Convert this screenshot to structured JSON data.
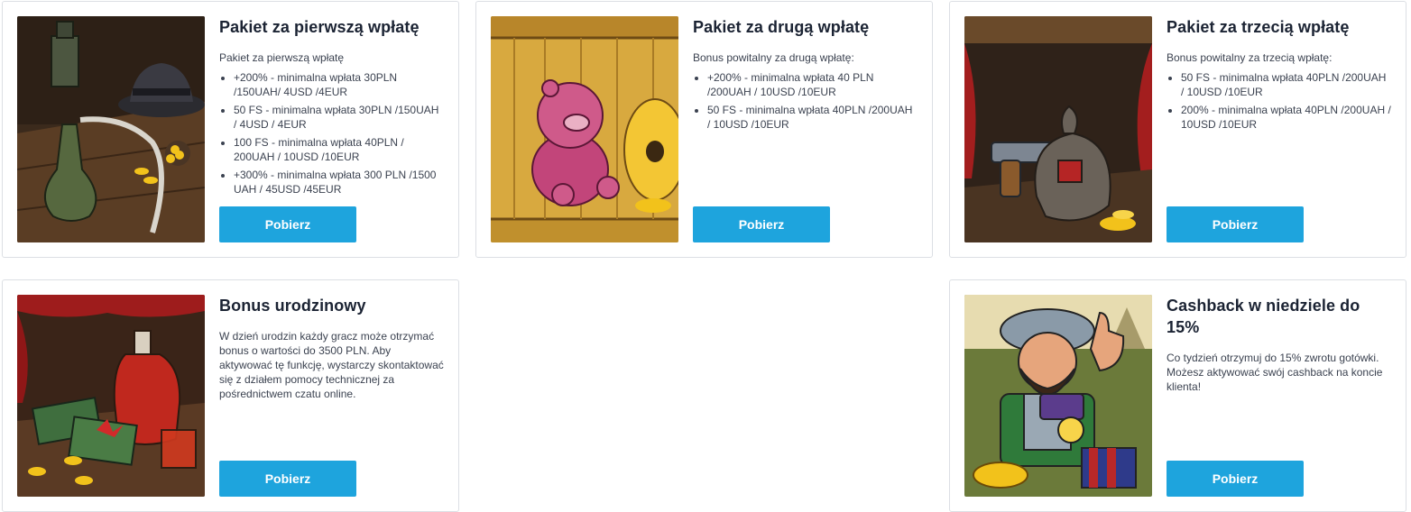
{
  "cards": [
    {
      "title": "Pakiet za pierwszą wpłatę",
      "description": "Pakiet za pierwszą wpłatę",
      "items": [
        "+200% - minimalna wpłata 30PLN /150UAH/ 4USD /4EUR",
        "50 FS - minimalna wpłata 30PLN /150UAH / 4USD / 4EUR",
        "100 FS - minimalna wpłata 40PLN / 200UAH / 10USD /10EUR",
        "+300% - minimalna wpłata 300 PLN /1500 UAH / 45USD /45EUR"
      ],
      "button": "Pobierz",
      "image": "adventure-hat-bottle-illustration"
    },
    {
      "title": "Pakiet za drugą wpłatę",
      "description": "Bonus powitalny za drugą wpłatę:",
      "items": [
        "+200% - minimalna wpłata 40 PLN /200UAH / 10USD /10EUR",
        "50 FS - minimalna wpłata 40PLN /200UAH / 10USD /10EUR"
      ],
      "button": "Pobierz",
      "image": "pink-pig-toy-beehive-illustration"
    },
    {
      "title": "Pakiet za trzecią wpłatę",
      "description": "Bonus powitalny za trzecią wpłatę:",
      "items": [
        "50 FS - minimalna wpłata 40PLN /200UAH / 10USD /10EUR",
        "200% - minimalna wpłata 40PLN /200UAH / 10USD /10EUR"
      ],
      "button": "Pobierz",
      "image": "revolver-money-bag-illustration"
    },
    {
      "title": "Bonus urodzinowy",
      "description": "W dzień urodzin każdy gracz może otrzymać bonus o wartości do 3500 PLN. Aby aktywować tę funkcję, wystarczy skontaktować się z działem pomocy technicznej za pośrednictwem czatu online.",
      "items": [],
      "button": "Pobierz",
      "image": "liquor-bottle-banknotes-illustration"
    },
    {
      "title": "Cashback w niedziele do 15%",
      "description": "Co tydzień otrzymuj do 15% zwrotu gotówki. Możesz aktywować swój cashback na koncie klienta!",
      "items": [],
      "button": "Pobierz",
      "image": "conquistador-thumbs-up-illustration"
    }
  ],
  "colors": {
    "button": "#1ea4dd",
    "border": "#dcdfe4",
    "title": "#1b2333"
  }
}
